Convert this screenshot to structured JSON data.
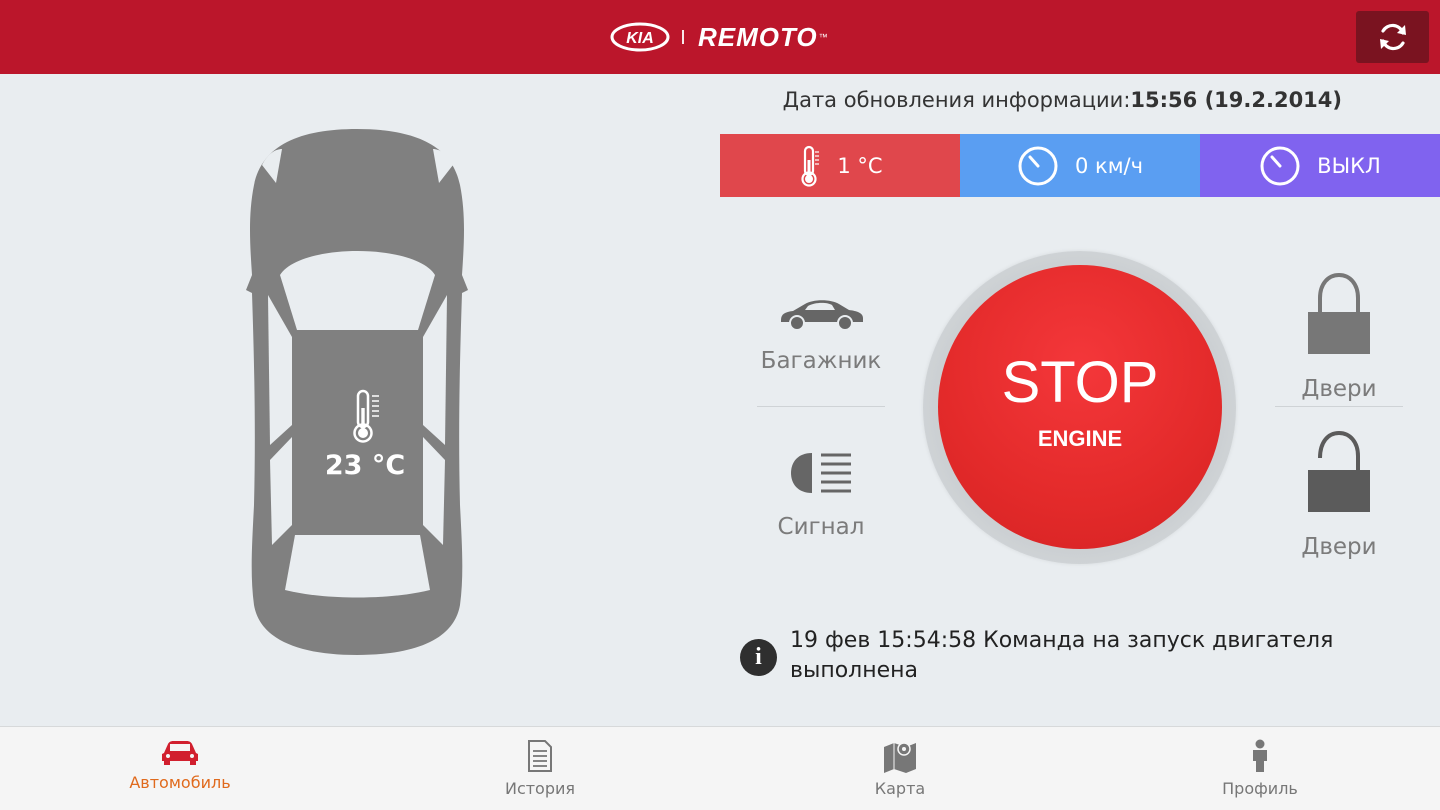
{
  "header": {
    "logo_text": "KIA",
    "app_name": "REMOTO",
    "trademark": "™"
  },
  "status": {
    "updated_label": "Дата обновления информации:",
    "updated_value": "15:56 (19.2.2014)"
  },
  "tiles": {
    "temperature": "1 °C",
    "speed": "0 км/ч",
    "engine": "ВЫКЛ",
    "colors": {
      "temperature": "#e0474c",
      "speed": "#5a9ef2",
      "engine": "#8063ef"
    }
  },
  "car": {
    "interior_temp": "23 °C"
  },
  "controls": {
    "trunk_label": "Багажник",
    "signal_label": "Сигнал",
    "door_lock_label": "Двери",
    "door_unlock_label": "Двери"
  },
  "engine_button": {
    "title": "STOP",
    "subtitle": "ENGINE"
  },
  "info": {
    "message": "19 фев 15:54:58 Команда на запуск двигателя выполнена"
  },
  "nav": {
    "items": [
      {
        "label": "Автомобиль",
        "icon": "car-icon",
        "active": true
      },
      {
        "label": "История",
        "icon": "document-icon",
        "active": false
      },
      {
        "label": "Карта",
        "icon": "map-icon",
        "active": false
      },
      {
        "label": "Профиль",
        "icon": "person-icon",
        "active": false
      }
    ],
    "active_color": "#e06a1d"
  },
  "colors": {
    "header": "#bb162b",
    "stop_button": "#e32a2a"
  }
}
